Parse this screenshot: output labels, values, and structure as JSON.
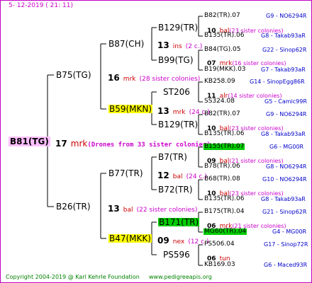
{
  "header": {
    "date": "5-  12-2019  ( 21:  11)"
  },
  "footer": {
    "copyright": "Copyright 2004-2019 @ Karl Kehrle Foundation",
    "url": "www.pedigreeapis.org"
  },
  "root": {
    "name": "B81(TG)",
    "num": "17",
    "mark": "mrk",
    "note": "(Drones from 33 sister colonies)"
  },
  "gen1": {
    "top": {
      "name": "B75(TG)",
      "num": "16",
      "mark": "mrk",
      "note": "(28 sister colonies)"
    },
    "bottom": {
      "name": "B26(TR)",
      "num": "13",
      "mark": "bal",
      "note": "(22 sister colonies)"
    }
  },
  "gen2": [
    {
      "name": "B87(CH)",
      "num": "13",
      "mark": "ins",
      "note": "(2 c.)"
    },
    {
      "name": "B59(MKN)",
      "num": "13",
      "mark": "mrk",
      "note": "(24 c.)"
    },
    {
      "name": "B77(TR)",
      "num": "12",
      "mark": "bal",
      "note": "(24 c.)"
    },
    {
      "name": "B47(MKK)",
      "num": "09",
      "mark": "nex",
      "note": "(12 c.)"
    }
  ],
  "gen3": [
    {
      "name": "B129(TR)",
      "num": "10",
      "mark": "bal",
      "note": "(23 sister colonies)"
    },
    {
      "name": "B99(TG)",
      "num": "07",
      "mark": "mrk",
      "note": "(16 sister colonies)"
    },
    {
      "name": "ST206",
      "num": "11",
      "mark": "alr",
      "note": "(14 sister colonies)"
    },
    {
      "name": "B129(TR)",
      "num": "10",
      "mark": "bal",
      "note": "(23 sister colonies)"
    },
    {
      "name": "B7(TR)",
      "num": "09",
      "mark": "bal",
      "note": "(21 sister colonies)"
    },
    {
      "name": "B72(TR)",
      "num": "10",
      "mark": "bal",
      "note": "(23 sister colonies)"
    },
    {
      "name": "B171(TR)",
      "num": "06",
      "mark": "mrk",
      "note": "(21 sister colonies)"
    },
    {
      "name": "PS596",
      "num": "06",
      "mark": "tun",
      "note": ""
    }
  ],
  "gen4": [
    {
      "name": "B82(TR).07",
      "code": "G9 - NO6294R"
    },
    {
      "name": "B135(TR).06",
      "code": "G8 - Takab93aR"
    },
    {
      "name": "B84(TG).05",
      "code": "G22 - Sinop62R"
    },
    {
      "name": "B19(MKK).03",
      "code": "G7 - Takab93aR"
    },
    {
      "name": "KB258.09",
      "code": "G14 - SinopEgg86R"
    },
    {
      "name": "SS324.08",
      "code": "G5 - Camic99R"
    },
    {
      "name": "B82(TR).07",
      "code": "G9 - NO6294R"
    },
    {
      "name": "B135(TR).06",
      "code": "G8 - Takab93aR"
    },
    {
      "name": "B155(TR).07",
      "code": "G6 - MG00R"
    },
    {
      "name": "B78(TR).06",
      "code": "G8 - NO6294R"
    },
    {
      "name": "B68(TR).08",
      "code": "G10 - NO6294R"
    },
    {
      "name": "B135(TR).06",
      "code": "G8 - Takab93aR"
    },
    {
      "name": "B175(TR).04",
      "code": "G21 - Sinop62R"
    },
    {
      "name": "MG60(TR).04",
      "code": "G4 - MG00R"
    },
    {
      "name": "PS506.04",
      "code": "G17 - Sinop72R"
    },
    {
      "name": "KB169.03",
      "code": "G6 - Maced93R"
    }
  ]
}
